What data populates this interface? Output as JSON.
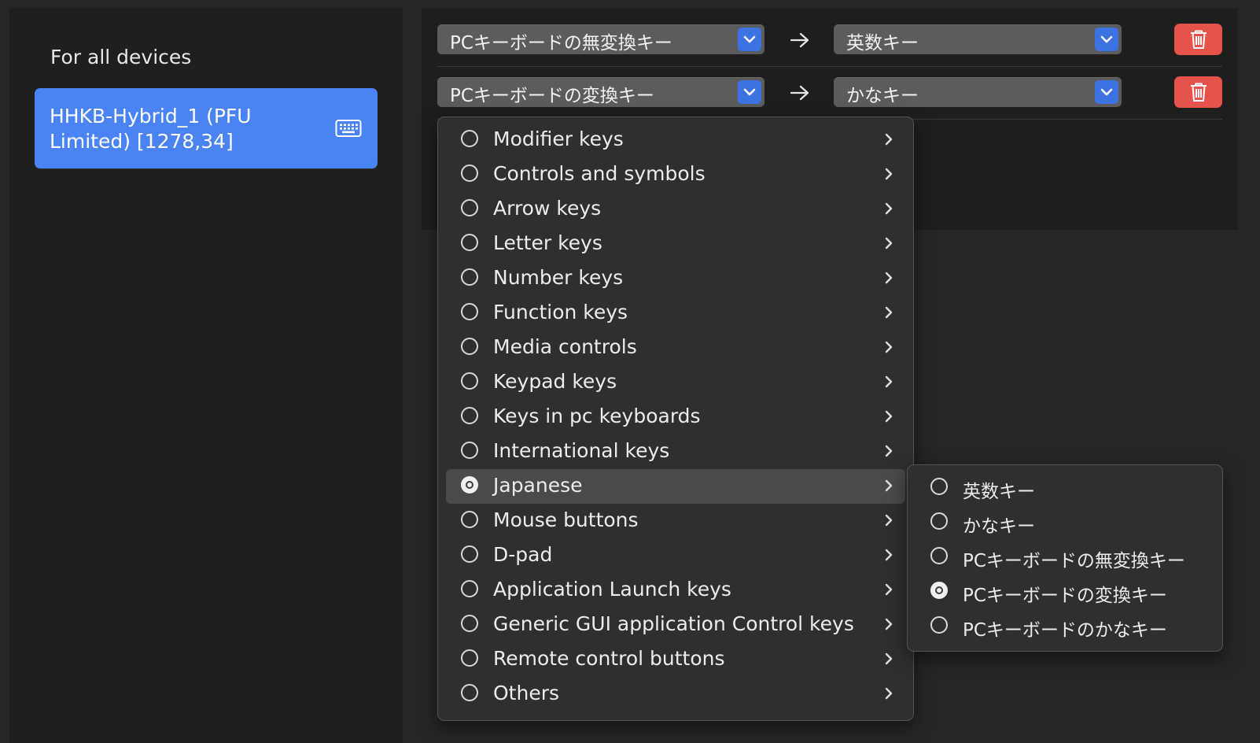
{
  "sidebar": {
    "header": "For all devices",
    "device": {
      "label_line1": "HHKB-Hybrid_1 (PFU",
      "label_line2": "Limited) [1278,34]",
      "icon": "keyboard-icon"
    }
  },
  "mappings": [
    {
      "from": "PCキーボードの無変換キー",
      "to": "英数キー"
    },
    {
      "from": "PCキーボードの変換キー",
      "to": "かなキー"
    }
  ],
  "category_menu": {
    "items": [
      {
        "label": "Modifier keys",
        "selected": false
      },
      {
        "label": "Controls and symbols",
        "selected": false
      },
      {
        "label": "Arrow keys",
        "selected": false
      },
      {
        "label": "Letter keys",
        "selected": false
      },
      {
        "label": "Number keys",
        "selected": false
      },
      {
        "label": "Function keys",
        "selected": false
      },
      {
        "label": "Media controls",
        "selected": false
      },
      {
        "label": "Keypad keys",
        "selected": false
      },
      {
        "label": "Keys in pc keyboards",
        "selected": false
      },
      {
        "label": "International keys",
        "selected": false
      },
      {
        "label": "Japanese",
        "selected": true
      },
      {
        "label": "Mouse buttons",
        "selected": false
      },
      {
        "label": "D-pad",
        "selected": false
      },
      {
        "label": "Application Launch keys",
        "selected": false
      },
      {
        "label": "Generic GUI application Control keys",
        "selected": false
      },
      {
        "label": "Remote control buttons",
        "selected": false
      },
      {
        "label": "Others",
        "selected": false
      }
    ]
  },
  "japanese_submenu": {
    "items": [
      {
        "label": "英数キー",
        "selected": false
      },
      {
        "label": "かなキー",
        "selected": false
      },
      {
        "label": "PCキーボードの無変換キー",
        "selected": false
      },
      {
        "label": "PCキーボードの変換キー",
        "selected": true
      },
      {
        "label": "PCキーボードのかなキー",
        "selected": false
      }
    ]
  },
  "colors": {
    "accent": "#4a84f4",
    "chevron_button": "#3d72e3",
    "delete": "#e5534b"
  }
}
